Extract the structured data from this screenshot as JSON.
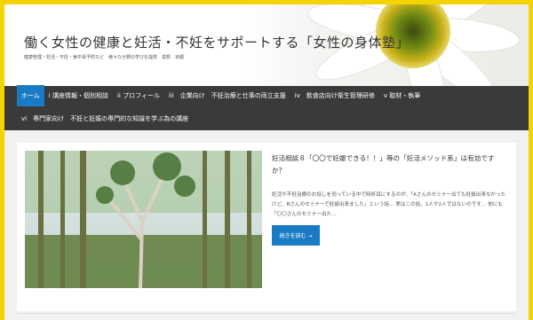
{
  "site": {
    "title": "働く女性の健康と妊活・不妊をサポートする「女性の身体塾」",
    "description": "健康管理・妊活・不妊・食中毒予防など　様々な分野の学びを提供　滋賀　京都"
  },
  "nav": {
    "row1": [
      {
        "label": "ホーム",
        "active": true
      },
      {
        "label": "i 講座情報・個別相談"
      },
      {
        "label": "ii プロフィール"
      },
      {
        "label": "iii　企業向け　不妊治療と仕事の両立支援"
      },
      {
        "label": "iv　飲食店向け衛生管理研修"
      },
      {
        "label": "v 取材・執筆"
      }
    ],
    "row2": [
      {
        "label": "vi　専門家向け　不妊と妊娠の専門的な知識を学ぶ為の講座"
      }
    ]
  },
  "post": {
    "title": "妊活相談８「〇〇で妊娠できる！！」等の「妊活メソッド系」は有効ですか？",
    "excerpt": "妊活や不妊治療のお話しを伺っている中で時折耳にするのが、「Aさんのセミナー出ても妊娠出来なかったけど、Bさんのセミナーで妊娠出来ました」という話… 実はこの話、1人や2人ではないのです… 他にも「〇〇さんのセミナー出た…",
    "read_more": "続きを読む →"
  },
  "colors": {
    "border": "#f3d400",
    "nav_bg": "#3a3a3a",
    "accent": "#1a7bc4"
  }
}
